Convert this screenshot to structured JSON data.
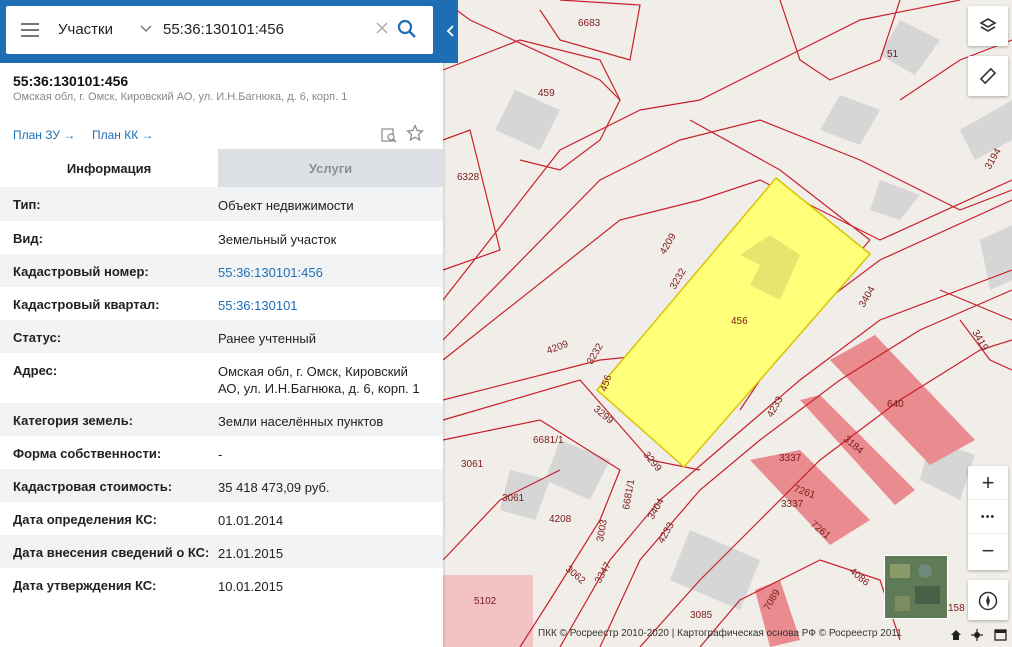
{
  "search": {
    "type": "Участки",
    "value": "55:36:130101:456"
  },
  "object": {
    "title": "55:36:130101:456",
    "address": "Омская обл, г. Омск, Кировский АО, ул. И.Н.Багнюка, д. 6, корп. 1"
  },
  "links": {
    "plan_zu": "План ЗУ →",
    "plan_kk": "План КК →"
  },
  "tabs": {
    "info": "Информация",
    "services": "Услуги"
  },
  "info_rows": [
    {
      "label": "Тип:",
      "value": "Объект недвижимости"
    },
    {
      "label": "Вид:",
      "value": "Земельный участок"
    },
    {
      "label": "Кадастровый номер:",
      "value": "55:36:130101:456"
    },
    {
      "label": "Кадастровый квартал:",
      "value": "55:36:130101"
    },
    {
      "label": "Статус:",
      "value": "Ранее учтенный"
    },
    {
      "label": "Адрес:",
      "value": "Омская обл, г. Омск, Кировский АО, ул. И.Н.Багнюка, д. 6, корп. 1"
    },
    {
      "label": "Категория земель:",
      "value": "Земли населённых пунктов"
    },
    {
      "label": "Форма собственности:",
      "value": "-"
    },
    {
      "label": "Кадастровая стоимость:",
      "value": "35 418 473,09 руб."
    },
    {
      "label": "Дата определения КС:",
      "value": "01.01.2014"
    },
    {
      "label": "Дата внесения сведений о КС:",
      "value": "21.01.2015"
    },
    {
      "label": "Дата утверждения КС:",
      "value": "10.01.2015"
    }
  ],
  "map": {
    "labels": [
      "6683",
      "51",
      "459",
      "6328",
      "3194",
      "4209",
      "3232",
      "456",
      "3404",
      "3419",
      "4209",
      "3232",
      "456",
      "3299",
      "640",
      "3184",
      "4233",
      "6681/1",
      "3061",
      "3299",
      "3337",
      "7261",
      "3337",
      "7261",
      "3061",
      "4208",
      "3003",
      "6681/1",
      "3404",
      "3062",
      "3347",
      "4233",
      "4086",
      "5102",
      "3085",
      "7089",
      "158"
    ],
    "highlight_color": "#ffff7a",
    "parcel_color": "#c8202a"
  },
  "controls": {
    "zoom_in": "+",
    "zoom_more": "•••",
    "zoom_out": "−"
  },
  "copyright": "ПКК © Росреестр 2010-2020 | Картографическая основа РФ © Росреестр 2011"
}
